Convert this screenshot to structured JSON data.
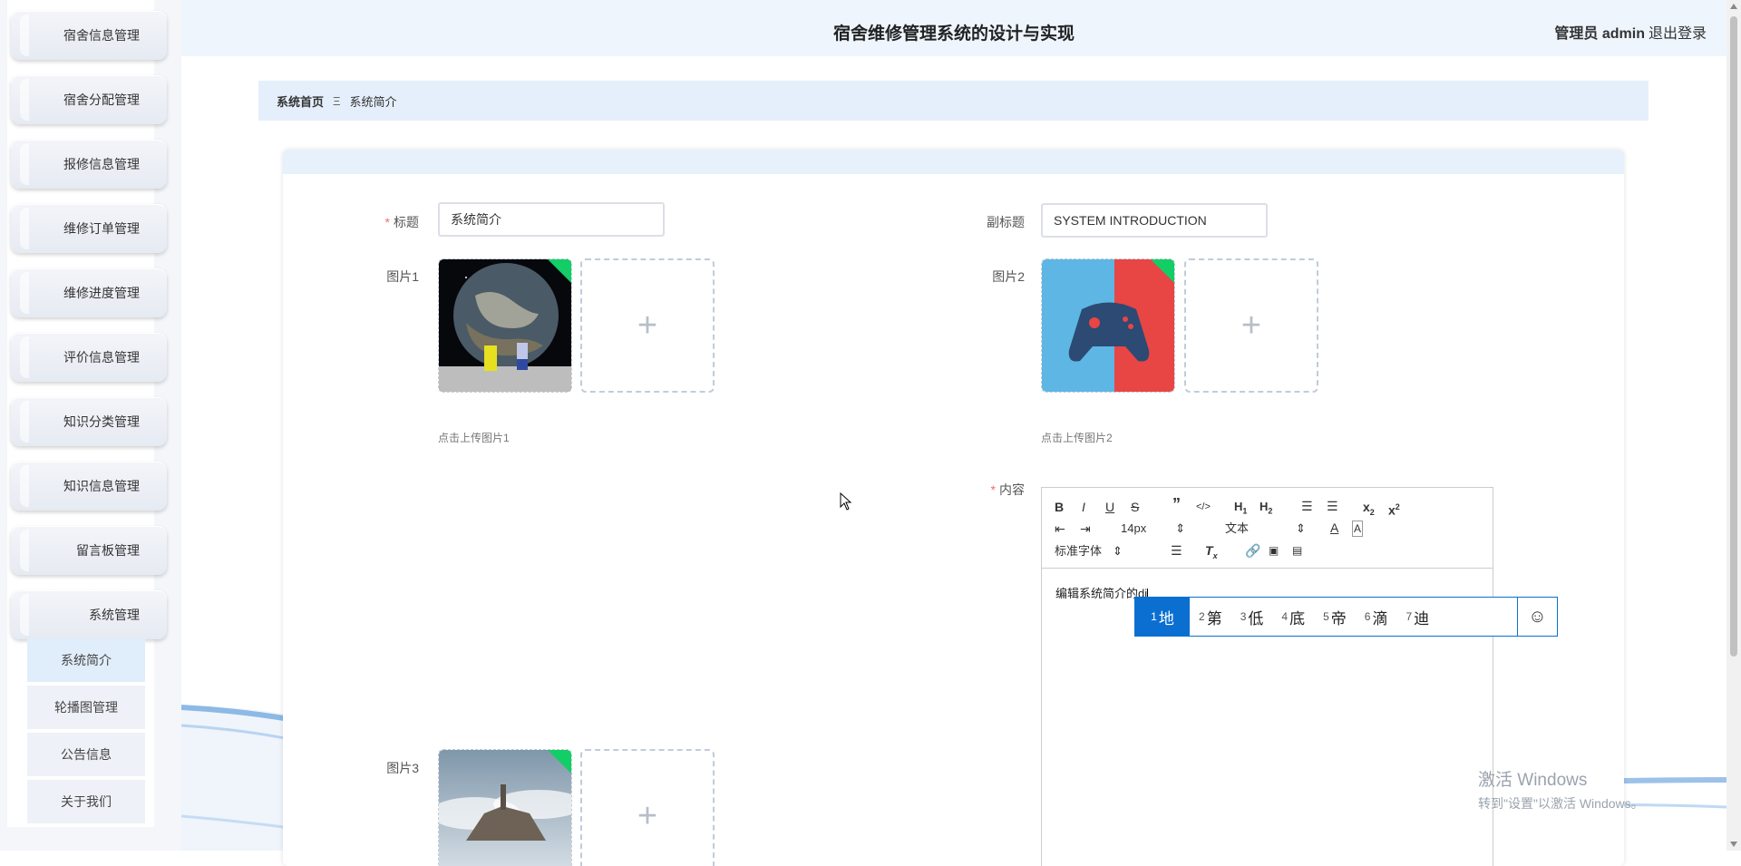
{
  "header": {
    "title": "宿舍维修管理系统的设计与实现",
    "user": "管理员 admin",
    "logout": "退出登录"
  },
  "sidebar": {
    "menus": [
      {
        "label": "宿舍信息管理"
      },
      {
        "label": "宿舍分配管理"
      },
      {
        "label": "报修信息管理"
      },
      {
        "label": "维修订单管理"
      },
      {
        "label": "维修进度管理"
      },
      {
        "label": "评价信息管理"
      },
      {
        "label": "知识分类管理"
      },
      {
        "label": "知识信息管理"
      },
      {
        "label": "留言板管理"
      },
      {
        "label": "系统管理"
      }
    ],
    "submenu": [
      {
        "label": "系统简介",
        "active": true
      },
      {
        "label": "轮播图管理"
      },
      {
        "label": "公告信息"
      },
      {
        "label": "关于我们"
      }
    ]
  },
  "breadcrumb": {
    "home": "系统首页",
    "separator": "Ξ",
    "current": "系统简介"
  },
  "form": {
    "title_label": "标题",
    "title_value": "系统简介",
    "subtitle_label": "副标题",
    "subtitle_value": "SYSTEM INTRODUCTION",
    "image1_label": "图片1",
    "image1_hint": "点击上传图片1",
    "image2_label": "图片2",
    "image2_hint": "点击上传图片2",
    "image3_label": "图片3",
    "content_label": "内容",
    "required_mark": "*"
  },
  "editor": {
    "font_size": "14px",
    "block_format": "文本",
    "font_family": "标准字体",
    "text": "编辑系统简介的di"
  },
  "ime": {
    "candidates": [
      {
        "num": "1",
        "char": "地"
      },
      {
        "num": "2",
        "char": "第"
      },
      {
        "num": "3",
        "char": "低"
      },
      {
        "num": "4",
        "char": "底"
      },
      {
        "num": "5",
        "char": "帝"
      },
      {
        "num": "6",
        "char": "滴"
      },
      {
        "num": "7",
        "char": "迪"
      }
    ]
  },
  "watermark": {
    "line1": "激活 Windows",
    "line2": "转到\"设置\"以激活 Windows。"
  },
  "colors": {
    "accent": "#0b6fd1",
    "required": "#f56c6c",
    "header_bg": "#eef5fd",
    "breadcrumb_bg": "#e4effb"
  }
}
